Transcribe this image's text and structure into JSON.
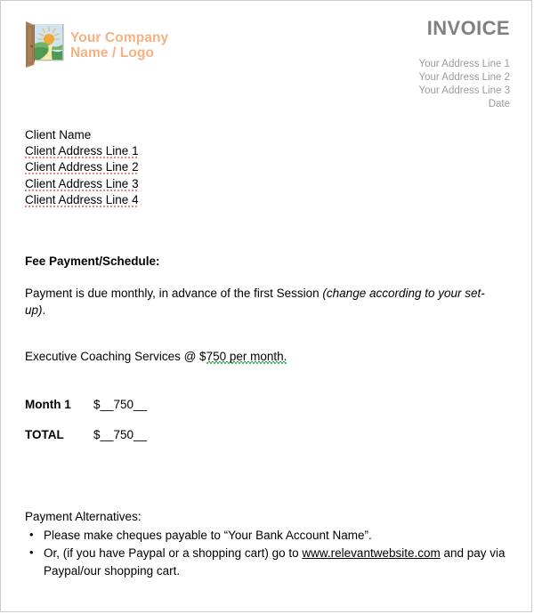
{
  "header": {
    "company_name": "Your Company\nName / Logo",
    "company_name_color": "#F6B183",
    "invoice_title": "INVOICE",
    "invoice_title_color": "#808080",
    "address_color": "#9B9B9B",
    "address_lines": [
      "Your Address Line 1",
      "Your Address Line 2",
      "Your Address Line 3",
      "Date"
    ],
    "logo_icon": "open-door-sunrise-icon"
  },
  "client": {
    "lines": [
      "Client Name",
      "Client Address Line 1",
      "Client Address Line 2",
      "Client Address Line 3",
      "Client Address Line 4"
    ]
  },
  "fee_section": {
    "title": "Fee Payment/Schedule:",
    "due_text_before": "Payment is due monthly, in advance of the first Session ",
    "due_text_italic": "(change according to your set-up)",
    "due_text_after": ".",
    "service_prefix": "Executive Coaching Services @ $",
    "service_rate": "750",
    "service_suffix": " per month."
  },
  "amounts": {
    "rows": [
      {
        "label": "Month 1",
        "value": "$__750__"
      },
      {
        "label": "TOTAL",
        "value": "$__750__"
      }
    ]
  },
  "payment_alternatives": {
    "heading": "Payment Alternatives:",
    "item_1": "Please make cheques payable to “Your Bank Account Name”.",
    "item_2_before": "Or, (if you have Paypal or a shopping cart) go to ",
    "item_2_link": "www.relevantwebsite.com",
    "item_2_after": " and pay via Paypal/our shopping cart."
  }
}
